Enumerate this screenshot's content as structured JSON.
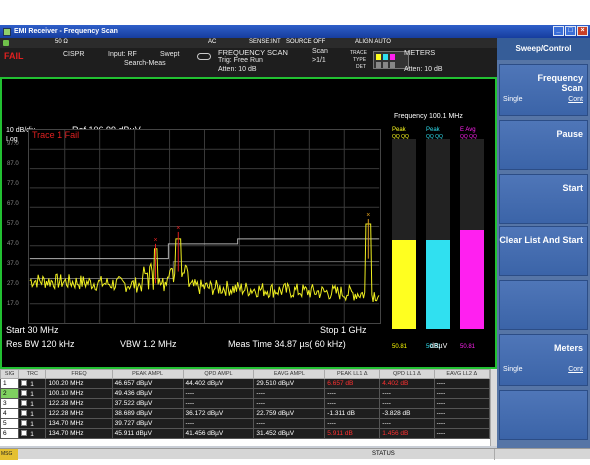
{
  "window": {
    "title": "EMI Receiver - Frequency Scan",
    "buttons": [
      "_",
      "□",
      "×"
    ]
  },
  "top_strip": {
    "ohm": "50 Ω",
    "coupling": "AC",
    "sense": "SENSE:INT",
    "source": "SOURCE OFF",
    "align": "ALIGN AUTO"
  },
  "header": {
    "fail": "FAIL",
    "detector_std": "CISPR",
    "input": "Input: RF",
    "sweep_type": "Swept",
    "search_meas": "Search-Meas",
    "mode": "FREQUENCY SCAN",
    "trig": "Trig: Free Run",
    "atten_left": "Atten: 10 dB",
    "scan_label": "Scan",
    "scan_count": ">1/1",
    "trace_label": "TRACE",
    "type_label": "TYPE",
    "det_label": "DET",
    "meters_label": "METERS",
    "atten_right": "Atten: 10 dB"
  },
  "plot": {
    "scale": "10 dB/div",
    "log": "Log",
    "ref": "Ref 106.99 dBµV",
    "trace_status": "Trace 1 Fail",
    "y_ticks": [
      "97.0",
      "87.0",
      "77.0",
      "67.0",
      "57.0",
      "47.0",
      "37.0",
      "27.0",
      "17.0"
    ],
    "start": "Start 30 MHz",
    "stop": "Stop 1 GHz",
    "res_bw": "Res BW 120 kHz",
    "vbw": "VBW 1.2 MHz",
    "meas_time": "Meas Time 34.87 µs( 60 kHz)"
  },
  "meters": {
    "frequency": "Frequency  100.1 MHz",
    "headers": [
      "Peak",
      "Peak",
      "E Avg"
    ],
    "subheaders": [
      "QQ QQ",
      "QQ QQ",
      "QQ QQ"
    ],
    "values": [
      "50.81",
      "50.81",
      "50.81"
    ],
    "unit": "dBµV",
    "levels": [
      0.47,
      0.47,
      0.52
    ],
    "colors": [
      "#ffff20",
      "#30e0f0",
      "#ff20f0"
    ]
  },
  "table": {
    "headers": [
      "SIG",
      "TRC",
      "FREQ",
      "PEAK AMPL",
      "QPD AMPL",
      "EAVG AMPL",
      "PEAK LL1 Δ",
      "QPD LL1 Δ",
      "EAVG LL2 Δ"
    ],
    "rows": [
      {
        "sig": "1",
        "trc": "1",
        "freq": "100.20 MHz",
        "peak": "46.657 dBµV",
        "qpd": "44.402 dBµV",
        "eavg": "29.510 dBµV",
        "pll1": "6.657 dB",
        "qll1": "4.402 dB",
        "ell2": "----",
        "bad": [
          true,
          true
        ]
      },
      {
        "sig": "2",
        "trc": "1",
        "freq": "100.10 MHz",
        "peak": "49.436 dBµV",
        "qpd": "----",
        "eavg": "----",
        "pll1": "----",
        "qll1": "----",
        "ell2": "----",
        "bad": [
          false,
          false
        ],
        "selected": true
      },
      {
        "sig": "3",
        "trc": "1",
        "freq": "122.28 MHz",
        "peak": "37.522 dBµV",
        "qpd": "----",
        "eavg": "----",
        "pll1": "----",
        "qll1": "----",
        "ell2": "----",
        "bad": [
          false,
          false
        ]
      },
      {
        "sig": "4",
        "trc": "1",
        "freq": "122.28 MHz",
        "peak": "38.689 dBµV",
        "qpd": "36.172 dBµV",
        "eavg": "22.759 dBµV",
        "pll1": "-1.311 dB",
        "qll1": "-3.828 dB",
        "ell2": "----",
        "bad": [
          false,
          false
        ]
      },
      {
        "sig": "5",
        "trc": "1",
        "freq": "134.70 MHz",
        "peak": "39.727 dBµV",
        "qpd": "----",
        "eavg": "----",
        "pll1": "----",
        "qll1": "----",
        "ell2": "----",
        "bad": [
          false,
          false
        ]
      },
      {
        "sig": "6",
        "trc": "1",
        "freq": "134.70 MHz",
        "peak": "45.911 dBµV",
        "qpd": "41.456 dBµV",
        "eavg": "31.452 dBµV",
        "pll1": "5.911 dB",
        "qll1": "1.456 dB",
        "ell2": "----",
        "bad": [
          true,
          true
        ]
      }
    ]
  },
  "status": {
    "msg": "MSG",
    "status": "STATUS"
  },
  "softkeys": {
    "title": "Sweep/Control",
    "keys": [
      {
        "label": "Frequency Scan",
        "left": "Single",
        "right": "Cont"
      },
      {
        "label": "Pause"
      },
      {
        "label": "Start"
      },
      {
        "label": "Clear List And Start"
      },
      {
        "label": ""
      },
      {
        "label": "Meters",
        "left": "Single",
        "right": "Cont"
      },
      {
        "label": ""
      }
    ]
  },
  "colors": {
    "trace": "#f0f020",
    "limit": "#b0b0b0",
    "panel": "#3b64a8",
    "fail": "#e02020"
  }
}
